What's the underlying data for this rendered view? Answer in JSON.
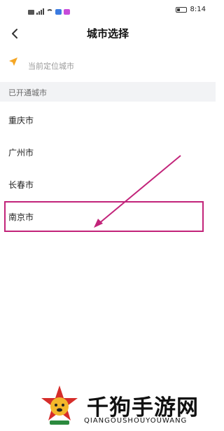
{
  "status_bar": {
    "time": "8:14",
    "network": "4G",
    "app_icon_colors": [
      "#3b7be0",
      "#c74bd9"
    ]
  },
  "header": {
    "title": "城市选择",
    "back_icon": "chevron-left-icon"
  },
  "location": {
    "icon": "location-arrow-icon",
    "icon_color": "#f5a623",
    "label": "当前定位城市"
  },
  "section": {
    "label": "已开通城市"
  },
  "cities": [
    {
      "name": "重庆市"
    },
    {
      "name": "广州市"
    },
    {
      "name": "长春市"
    },
    {
      "name": "南京市"
    }
  ],
  "annotation": {
    "highlight_color": "#c2247a",
    "highlighted_city": "南京市"
  },
  "watermark": {
    "title": "千狗手游网",
    "subtitle": "QIANGOUSHOUYOUWANG",
    "logo_colors": [
      "#d62d2a",
      "#f3b72b"
    ]
  }
}
